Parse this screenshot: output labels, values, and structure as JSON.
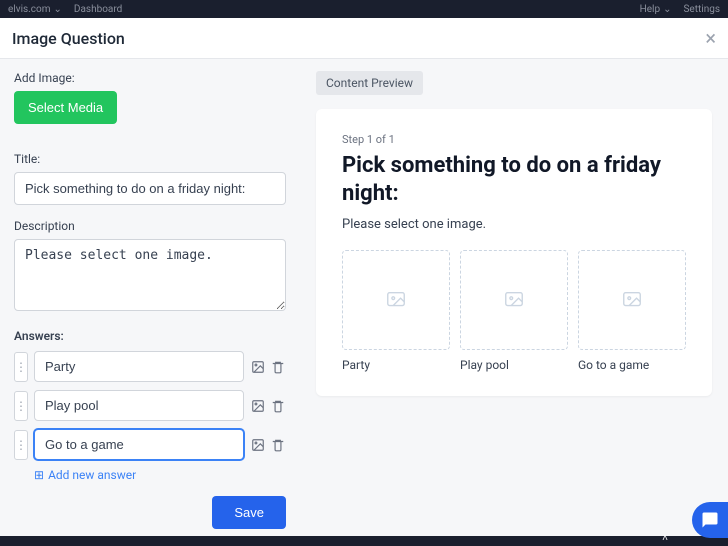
{
  "topbar": {
    "site": "elvis.com",
    "dashboard": "Dashboard",
    "help": "Help",
    "settings": "Settings"
  },
  "modal": {
    "title": "Image Question"
  },
  "form": {
    "addImageLabel": "Add Image:",
    "selectMediaLabel": "Select Media",
    "titleLabel": "Title:",
    "titleValue": "Pick something to do on a friday night:",
    "descriptionLabel": "Description",
    "descriptionValue": "Please select one image.",
    "answersLabel": "Answers:",
    "answers": [
      {
        "text": "Party"
      },
      {
        "text": "Play pool"
      },
      {
        "text": "Go to a game"
      }
    ],
    "addAnswerLabel": "Add new answer",
    "saveLabel": "Save"
  },
  "preview": {
    "tabLabel": "Content Preview",
    "stepText": "Step 1 of 1",
    "title": "Pick something to do on a friday night:",
    "description": "Please select one image.",
    "options": [
      {
        "label": "Party"
      },
      {
        "label": "Play pool"
      },
      {
        "label": "Go to a game"
      }
    ]
  }
}
